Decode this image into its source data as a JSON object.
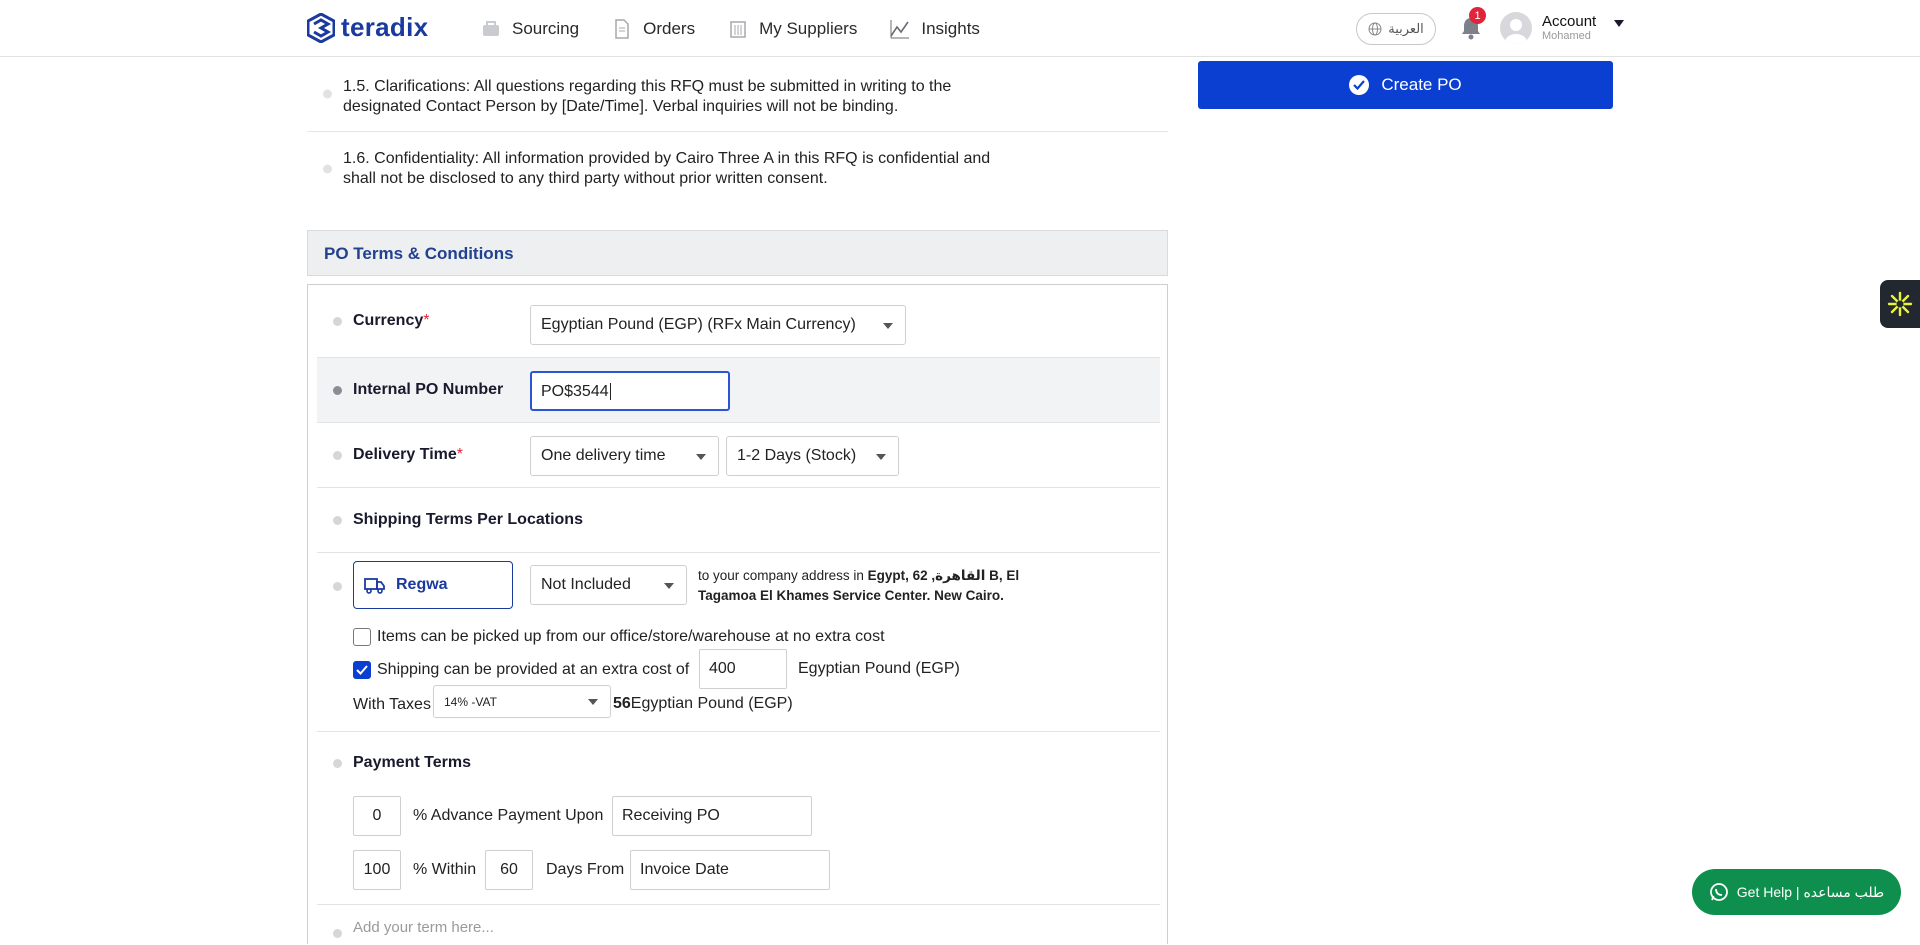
{
  "brand": {
    "name": "teradix",
    "color": "#1b3a9e"
  },
  "nav": {
    "items": [
      {
        "label": "Sourcing",
        "icon": "sourcing-icon"
      },
      {
        "label": "Orders",
        "icon": "orders-icon"
      },
      {
        "label": "My Suppliers",
        "icon": "suppliers-icon"
      },
      {
        "label": "Insights",
        "icon": "insights-icon"
      }
    ]
  },
  "header": {
    "language_label": "العربية",
    "notification_count": "1",
    "account_label": "Account",
    "account_user": "Mohamed"
  },
  "rfq_terms": [
    {
      "text": "1.5. Clarifications: All questions regarding this RFQ must be submitted in writing to the designated Contact Person by [Date/Time]. Verbal inquiries will not be binding."
    },
    {
      "text": "1.6. Confidentiality: All information provided by Cairo Three A in this RFQ is confidential and shall not be disclosed to any third party without prior written consent."
    }
  ],
  "po_section": {
    "title": "PO Terms & Conditions",
    "currency": {
      "label": "Currency",
      "required_mark": "*",
      "value": "Egyptian Pound (EGP) (RFx Main Currency)"
    },
    "internal_po": {
      "label": "Internal PO Number",
      "value": "PO$3544"
    },
    "delivery": {
      "label": "Delivery Time",
      "required_mark": "*",
      "mode": "One delivery time",
      "duration": "1-2 Days (Stock)"
    },
    "shipping_header": "Shipping Terms Per Locations",
    "location": {
      "name": "Regwa",
      "shipping_option": "Not Included",
      "address_prefix": "to your company address in",
      "address_bold_line1": "Egypt, 62 ,القاهرة B, El",
      "address_bold_line2": "Tagamoa El Khames Service Center. New Cairo."
    },
    "pickup_checkbox": {
      "label": "Items can be picked up from our office/store/warehouse at no extra cost",
      "checked": false
    },
    "shipping_checkbox": {
      "label": "Shipping can be provided at an extra cost of",
      "checked": true,
      "cost": "400",
      "currency": "Egyptian Pound (EGP)"
    },
    "taxes": {
      "label": "With Taxes",
      "tax_option": "14% -VAT",
      "tax_amount": "56",
      "currency": "Egyptian Pound (EGP)"
    },
    "payment": {
      "label": "Payment Terms",
      "advance_percent": "0",
      "advance_text": "% Advance Payment Upon",
      "advance_upon": "Receiving PO",
      "within_percent": "100",
      "within_text": "% Within",
      "days": "60",
      "days_from_text": "Days From",
      "days_from": "Invoice Date"
    },
    "add_term_placeholder": "Add your term here..."
  },
  "actions": {
    "create_po_label": "Create PO"
  },
  "help": {
    "label": "Get Help | طلب مساعده"
  },
  "colors": {
    "primary": "#0a3fd1",
    "help_green": "#0e8f4e",
    "badge_red": "#e0243a"
  }
}
